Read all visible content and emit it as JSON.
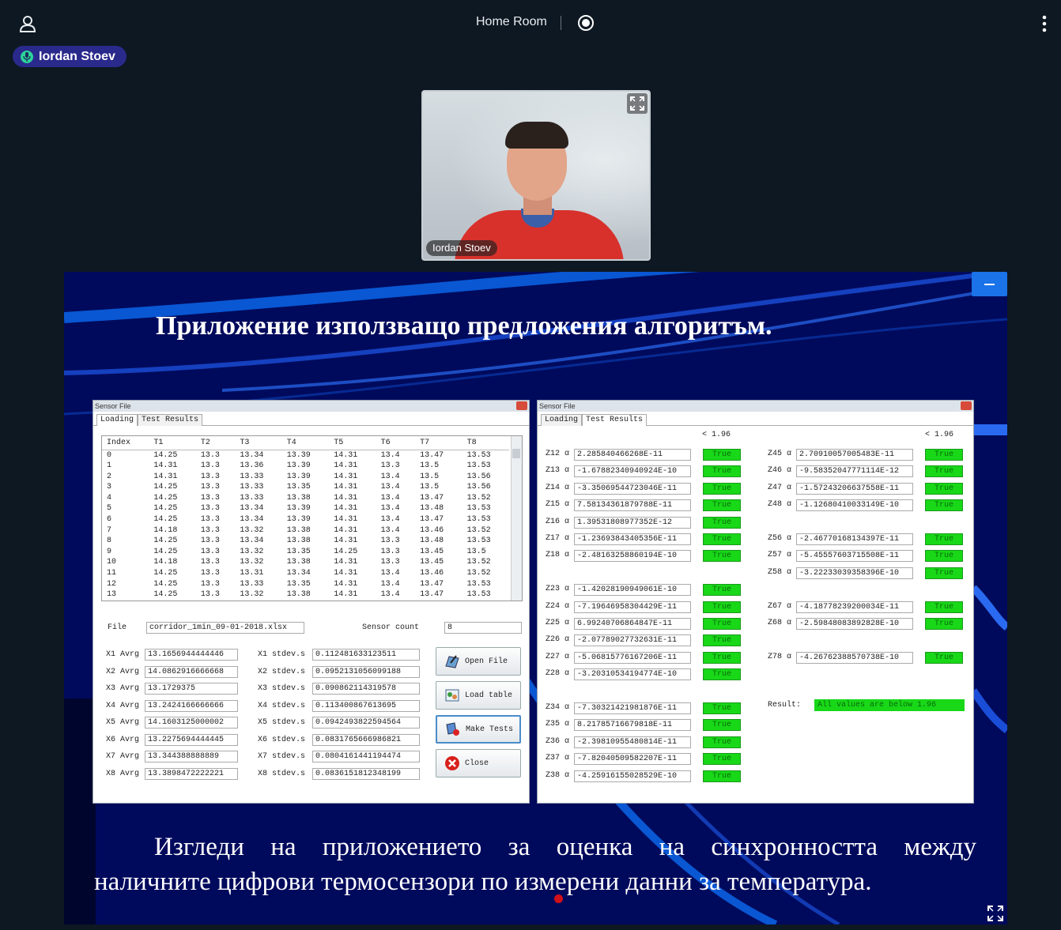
{
  "header": {
    "room_title": "Home Room"
  },
  "speaker": {
    "name": "Iordan Stoev"
  },
  "video": {
    "label": "Iordan Stoev"
  },
  "slide": {
    "title": "Приложение използващо предложения алгоритъм.",
    "caption_line1": "Изгледи на приложението за оценка на синхронността между",
    "caption_line2": "наличните цифрови термосензори по измерени данни за температура."
  },
  "left_window": {
    "title": "Sensor File",
    "tabs": [
      "Loading",
      "Test Results"
    ],
    "columns": [
      "Index",
      "T1",
      "T2",
      "T3",
      "T4",
      "T5",
      "T6",
      "T7",
      "T8"
    ],
    "rows": [
      [
        "0",
        "14.25",
        "13.3",
        "13.34",
        "13.39",
        "14.31",
        "13.4",
        "13.47",
        "13.53"
      ],
      [
        "1",
        "14.31",
        "13.3",
        "13.36",
        "13.39",
        "14.31",
        "13.3",
        "13.5",
        "13.53"
      ],
      [
        "2",
        "14.31",
        "13.3",
        "13.33",
        "13.39",
        "14.31",
        "13.4",
        "13.5",
        "13.56"
      ],
      [
        "3",
        "14.25",
        "13.3",
        "13.33",
        "13.35",
        "14.31",
        "13.4",
        "13.5",
        "13.56"
      ],
      [
        "4",
        "14.25",
        "13.3",
        "13.33",
        "13.38",
        "14.31",
        "13.4",
        "13.47",
        "13.52"
      ],
      [
        "5",
        "14.25",
        "13.3",
        "13.34",
        "13.39",
        "14.31",
        "13.4",
        "13.48",
        "13.53"
      ],
      [
        "6",
        "14.25",
        "13.3",
        "13.34",
        "13.39",
        "14.31",
        "13.4",
        "13.47",
        "13.53"
      ],
      [
        "7",
        "14.18",
        "13.3",
        "13.32",
        "13.38",
        "14.31",
        "13.4",
        "13.46",
        "13.52"
      ],
      [
        "8",
        "14.25",
        "13.3",
        "13.34",
        "13.38",
        "14.31",
        "13.3",
        "13.48",
        "13.53"
      ],
      [
        "9",
        "14.25",
        "13.3",
        "13.32",
        "13.35",
        "14.25",
        "13.3",
        "13.45",
        "13.5"
      ],
      [
        "10",
        "14.18",
        "13.3",
        "13.32",
        "13.38",
        "14.31",
        "13.3",
        "13.45",
        "13.52"
      ],
      [
        "11",
        "14.25",
        "13.3",
        "13.31",
        "13.34",
        "14.31",
        "13.4",
        "13.46",
        "13.52"
      ],
      [
        "12",
        "14.25",
        "13.3",
        "13.33",
        "13.35",
        "14.31",
        "13.4",
        "13.47",
        "13.53"
      ],
      [
        "13",
        "14.25",
        "13.3",
        "13.32",
        "13.38",
        "14.31",
        "13.4",
        "13.47",
        "13.53"
      ]
    ],
    "file_label": "File",
    "file_value": "corridor_1min_09-01-2018.xlsx",
    "sensor_count_label": "Sensor count",
    "sensor_count_value": "8",
    "avg": [
      {
        "label": "X1 Avrg",
        "value": "13.1656944444446"
      },
      {
        "label": "X2 Avrg",
        "value": "14.0862916666668"
      },
      {
        "label": "X3 Avrg",
        "value": "13.1729375"
      },
      {
        "label": "X4 Avrg",
        "value": "13.2424166666666"
      },
      {
        "label": "X5 Avrg",
        "value": "14.1603125000002"
      },
      {
        "label": "X6 Avrg",
        "value": "13.2275694444445"
      },
      {
        "label": "X7 Avrg",
        "value": "13.344388888889"
      },
      {
        "label": "X8 Avrg",
        "value": "13.3898472222221"
      }
    ],
    "stdev": [
      {
        "label": "X1 stdev.s",
        "value": "0.112481633123511"
      },
      {
        "label": "X2 stdev.s",
        "value": "0.0952131056099188"
      },
      {
        "label": "X3 stdev.s",
        "value": "0.090862114319578"
      },
      {
        "label": "X4 stdev.s",
        "value": "0.113400867613695"
      },
      {
        "label": "X5 stdev.s",
        "value": "0.0942493822594564"
      },
      {
        "label": "X6 stdev.s",
        "value": "0.0831765666986821"
      },
      {
        "label": "X7 stdev.s",
        "value": "0.0804161441194474"
      },
      {
        "label": "X8 stdev.s",
        "value": "0.0836151812348199"
      }
    ],
    "buttons": {
      "open": "Open File",
      "load": "Load table",
      "make": "Make Tests",
      "close": "Close"
    }
  },
  "right_window": {
    "title": "Sensor File",
    "tabs": [
      "Loading",
      "Test Results"
    ],
    "threshold": "< 1.96",
    "col1": [
      {
        "label": "Z12 α",
        "value": "2.285840466268E-11",
        "status": "True"
      },
      {
        "label": "Z13 α",
        "value": "-1.67882340940924E-10",
        "status": "True"
      },
      {
        "label": "Z14 α",
        "value": "-3.35069544723046E-11",
        "status": "True"
      },
      {
        "label": "Z15 α",
        "value": "7.58134361879788E-11",
        "status": "True"
      },
      {
        "label": "Z16 α",
        "value": "1.39531808977352E-12",
        "status": "True"
      },
      {
        "label": "Z17 α",
        "value": "-1.23693843405356E-11",
        "status": "True"
      },
      {
        "label": "Z18 α",
        "value": "-2.48163258860194E-10",
        "status": "True"
      },
      {
        "label": "Z23 α",
        "value": "-1.42028190949061E-10",
        "status": "True"
      },
      {
        "label": "Z24 α",
        "value": "-7.19646958304429E-11",
        "status": "True"
      },
      {
        "label": "Z25 α",
        "value": "6.99240706864847E-11",
        "status": "True"
      },
      {
        "label": "Z26 α",
        "value": "-2.07789027732631E-11",
        "status": "True"
      },
      {
        "label": "Z27 α",
        "value": "-5.06815776167206E-11",
        "status": "True"
      },
      {
        "label": "Z28 α",
        "value": "-3.20310534194774E-10",
        "status": "True"
      },
      {
        "label": "Z34 α",
        "value": "-7.30321421981876E-11",
        "status": "True"
      },
      {
        "label": "Z35 α",
        "value": "8.21785716679818E-11",
        "status": "True"
      },
      {
        "label": "Z36 α",
        "value": "-2.39810955480814E-11",
        "status": "True"
      },
      {
        "label": "Z37 α",
        "value": "-7.82040509582207E-11",
        "status": "True"
      },
      {
        "label": "Z38 α",
        "value": "-4.25916155028529E-10",
        "status": "True"
      }
    ],
    "col2": [
      {
        "label": "Z45 α",
        "value": "2.70910057005483E-11",
        "status": "True"
      },
      {
        "label": "Z46 α",
        "value": "-9.58352047771114E-12",
        "status": "True"
      },
      {
        "label": "Z47 α",
        "value": "-1.57243206637558E-11",
        "status": "True"
      },
      {
        "label": "Z48 α",
        "value": "-1.12680410033149E-10",
        "status": "True"
      },
      {
        "label": "Z56 α",
        "value": "-2.46770168134397E-11",
        "status": "True"
      },
      {
        "label": "Z57 α",
        "value": "-5.45557603715508E-11",
        "status": "True"
      },
      {
        "label": "Z58 α",
        "value": "-3.22233039358396E-10",
        "status": "True"
      },
      {
        "label": "Z67 α",
        "value": "-4.18778239200034E-11",
        "status": "True"
      },
      {
        "label": "Z68 α",
        "value": "-2.59848083892828E-10",
        "status": "True"
      },
      {
        "label": "Z78 α",
        "value": "-4.26762388570738E-10",
        "status": "True"
      }
    ],
    "result_label": "Result:",
    "result_value": "All values are below 1.96"
  }
}
